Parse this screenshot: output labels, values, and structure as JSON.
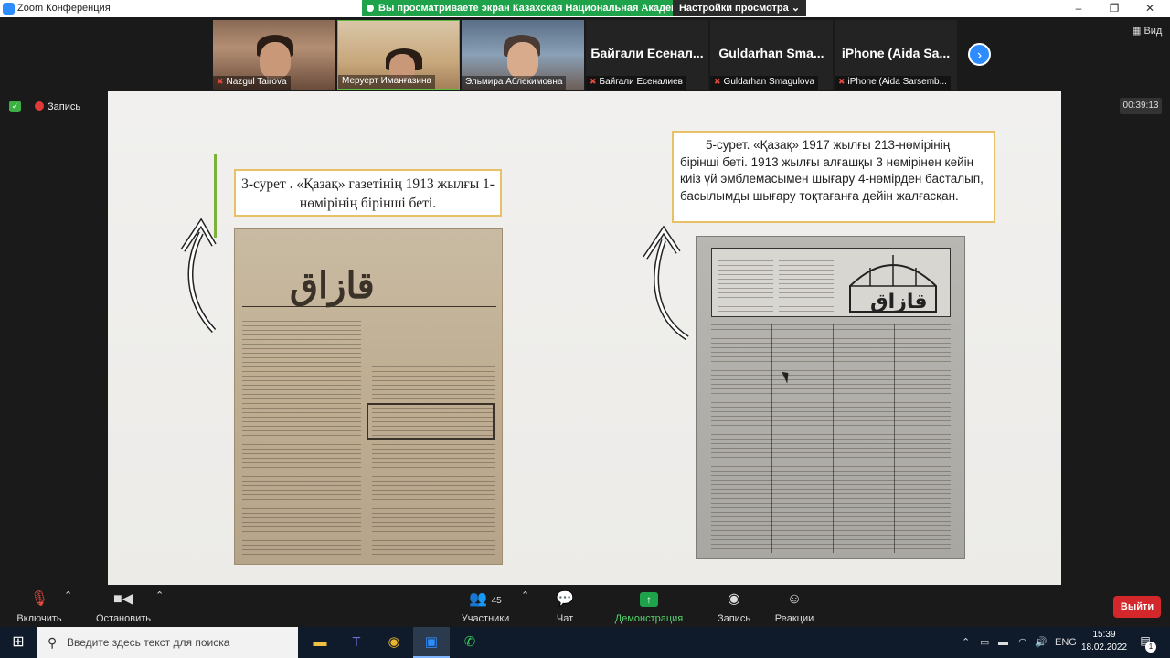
{
  "window": {
    "title": "Zoom Конференция",
    "minimize": "–",
    "maximize": "❐",
    "close": "✕"
  },
  "share_banner": {
    "text": "Вы просматриваете экран Казахская Национальная Академи...",
    "view_settings": "Настройки просмотра ⌄"
  },
  "participants": [
    {
      "name": "Nazgul Tairova",
      "muted": true,
      "video": true
    },
    {
      "name": "Меруерт Иманғазина",
      "muted": false,
      "video": true
    },
    {
      "name": "Эльмира Аблекимовна",
      "muted": false,
      "video": true
    },
    {
      "display": "Байгали Есенал...",
      "name": "Байгали Есеналиев",
      "muted": true,
      "video": false
    },
    {
      "display": "Guldarhan Sma...",
      "name": "Guldarhan Smagulova",
      "muted": true,
      "video": false
    },
    {
      "display": "iPhone (Aida Sa...",
      "name": "iPhone (Aida Sarsemb...",
      "muted": true,
      "video": false
    }
  ],
  "top_right": {
    "view_label": "Вид"
  },
  "status": {
    "recording_label": "Запись",
    "timer": "00:39:13"
  },
  "slide": {
    "caption_left": "3-сурет . «Қазақ» газетінің 1913 жылғы 1-нөмірінің бірінші беті.",
    "caption_right": "5-сурет. «Қазақ»  1917 жылғы 213-нөмірінің бірінші беті. 1913 жылғы алғашқы 3 нөмірінен кейін киіз үй эмблемасымен  шығару 4-нөмірден басталып, басылымды шығару тоқтағанға дейін жалғасқан.",
    "masthead_left": "قازاق",
    "masthead_right": "قازاق"
  },
  "controls": {
    "audio": "Включить звук",
    "video": "Остановить видео",
    "participants": "Участники",
    "participants_count": "45",
    "chat": "Чат",
    "share": "Демонстрация экрана",
    "record": "Запись",
    "reactions": "Реакции",
    "leave": "Выйти"
  },
  "taskbar": {
    "search_placeholder": "Введите здесь текст для поиска",
    "lang": "ENG",
    "time": "15:39",
    "date": "18.02.2022",
    "notifications": "1"
  },
  "colors": {
    "accent_blue": "#2d8cff",
    "share_green": "#1ea34a",
    "leave_red": "#d3272b",
    "caption_border": "#e8c067"
  }
}
